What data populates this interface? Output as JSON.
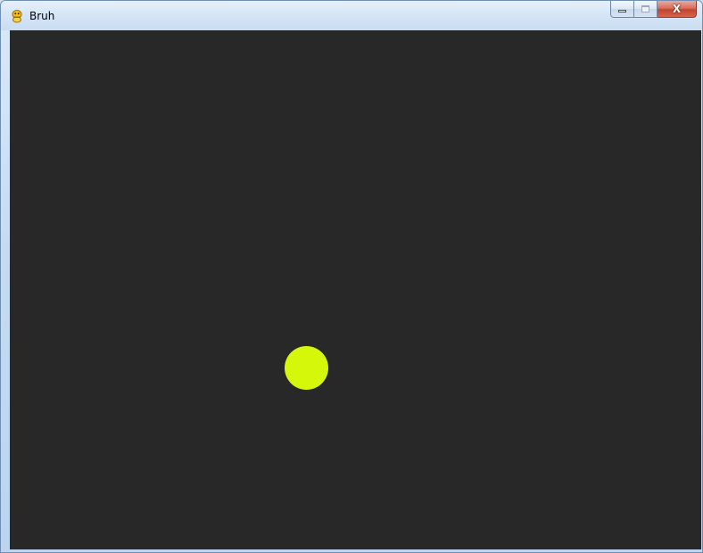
{
  "window": {
    "title": "Bruh",
    "icon": "pygame-snake-icon",
    "close_label": "X"
  },
  "game": {
    "background_color": "#282828",
    "ball_color": "#d4f70a"
  }
}
